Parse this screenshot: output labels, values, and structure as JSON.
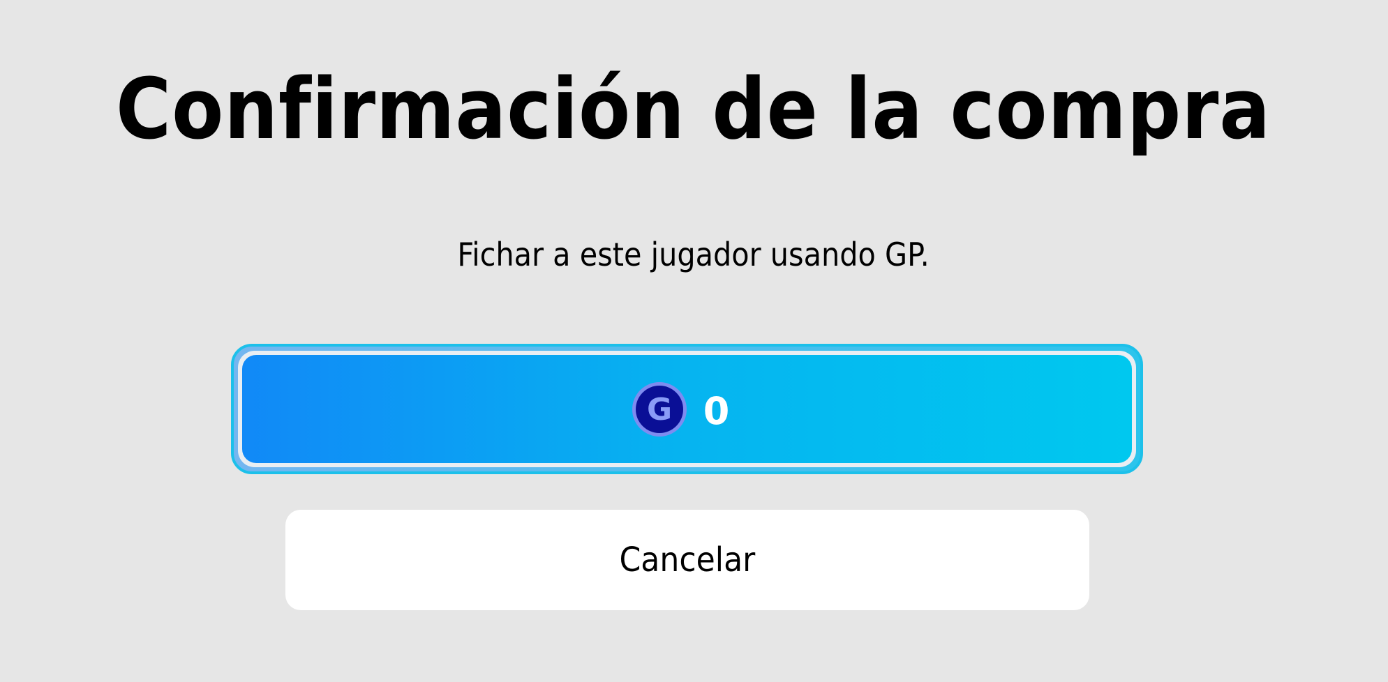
{
  "dialog": {
    "title": "Confirmación de la compra",
    "subtitle": "Fichar a este jugador usando GP."
  },
  "purchase_button": {
    "currency_icon": "gp-coin-icon",
    "currency_letter": "G",
    "price": "0",
    "gradient_start": "#1189f7",
    "gradient_end": "#00c8ef"
  },
  "cancel_button": {
    "label": "Cancelar"
  },
  "colors": {
    "background": "#e6e6e6",
    "coin_fill": "#0a0f96",
    "coin_ring": "#7e8cf0",
    "coin_letter": "#8a9cf7"
  }
}
